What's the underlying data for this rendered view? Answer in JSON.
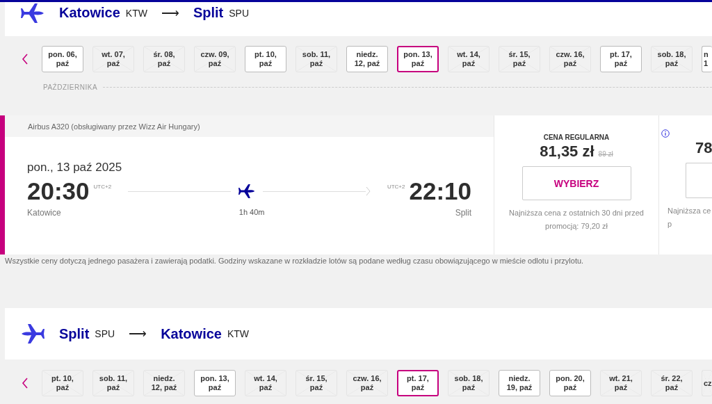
{
  "outbound": {
    "from_city": "Katowice",
    "from_code": "KTW",
    "arrow": "⟶",
    "to_city": "Split",
    "to_code": "SPU",
    "dates": [
      {
        "label": "pon. 06, paź",
        "available": true,
        "selected": false,
        "kind": "full"
      },
      {
        "label": "wt. 07, paź",
        "available": false,
        "selected": false,
        "kind": "full"
      },
      {
        "label": "śr. 08, paź",
        "available": false,
        "selected": false,
        "kind": "full"
      },
      {
        "label": "czw. 09, paź",
        "available": false,
        "selected": false,
        "kind": "full"
      },
      {
        "label": "pt. 10, paź",
        "available": true,
        "selected": false,
        "kind": "full"
      },
      {
        "label": "sob. 11, paź",
        "available": false,
        "selected": false,
        "kind": "full"
      },
      {
        "label": "niedz. 12, paź",
        "available": true,
        "selected": false,
        "kind": "full"
      },
      {
        "label": "pon. 13, paź",
        "available": true,
        "selected": true,
        "kind": "full"
      },
      {
        "label": "wt. 14, paź",
        "available": false,
        "selected": false,
        "kind": "full"
      },
      {
        "label": "śr. 15, paź",
        "available": false,
        "selected": false,
        "kind": "full"
      },
      {
        "label": "czw. 16, paź",
        "available": false,
        "selected": false,
        "kind": "full"
      },
      {
        "label": "pt. 17, paź",
        "available": true,
        "selected": false,
        "kind": "full"
      },
      {
        "label": "sob. 18, paź",
        "available": false,
        "selected": false,
        "kind": "full"
      },
      {
        "label": "n 1",
        "available": true,
        "selected": false,
        "kind": "cut"
      }
    ],
    "month": "PAŹDZIERNIKA",
    "flight": {
      "aircraft": "Airbus A320 (obsługiwany przez Wizz Air Hungary)",
      "date": "pon., 13 paź 2025",
      "dep_time": "20:30",
      "dep_tz": "UTC+2",
      "dep_city": "Katowice",
      "duration": "1h 40m",
      "arr_tz": "UTC+2",
      "arr_time": "22:10",
      "arr_city": "Split",
      "fares": [
        {
          "kind": "full",
          "title": "CENA REGULARNA",
          "price": "81,35 zł",
          "old_price": "89 zł",
          "button": "WYBIERZ",
          "note": "Najniższa cena z ostatnich 30 dni przed promocją: 79,20 zł"
        },
        {
          "kind": "cut",
          "price": "78",
          "note": "Najniższa ce p"
        }
      ]
    }
  },
  "disclaimer": "Wszystkie ceny dotyczą jednego pasażera i zawierają podatki. Godziny wskazane w rozkładzie lotów są podane według czasu obowiązującego w mieście odlotu i przylotu.",
  "return": {
    "from_city": "Split",
    "from_code": "SPU",
    "arrow": "⟶",
    "to_city": "Katowice",
    "to_code": "KTW",
    "dates": [
      {
        "label": "pt. 10, paź",
        "available": false,
        "selected": false,
        "kind": "full"
      },
      {
        "label": "sob. 11, paź",
        "available": false,
        "selected": false,
        "kind": "full"
      },
      {
        "label": "niedz. 12, paź",
        "available": false,
        "selected": false,
        "kind": "full"
      },
      {
        "label": "pon. 13, paź",
        "available": true,
        "selected": false,
        "kind": "full"
      },
      {
        "label": "wt. 14, paź",
        "available": false,
        "selected": false,
        "kind": "full"
      },
      {
        "label": "śr. 15, paź",
        "available": false,
        "selected": false,
        "kind": "full"
      },
      {
        "label": "czw. 16, paź",
        "available": false,
        "selected": false,
        "kind": "full"
      },
      {
        "label": "pt. 17, paź",
        "available": true,
        "selected": true,
        "kind": "full"
      },
      {
        "label": "sob. 18, paź",
        "available": false,
        "selected": false,
        "kind": "full"
      },
      {
        "label": "niedz. 19, paź",
        "available": true,
        "selected": false,
        "kind": "full"
      },
      {
        "label": "pon. 20, paź",
        "available": true,
        "selected": false,
        "kind": "full"
      },
      {
        "label": "wt. 21, paź",
        "available": false,
        "selected": false,
        "kind": "full"
      },
      {
        "label": "śr. 22, paź",
        "available": false,
        "selected": false,
        "kind": "full"
      },
      {
        "label": "cz",
        "available": false,
        "selected": false,
        "kind": "cut"
      }
    ]
  }
}
